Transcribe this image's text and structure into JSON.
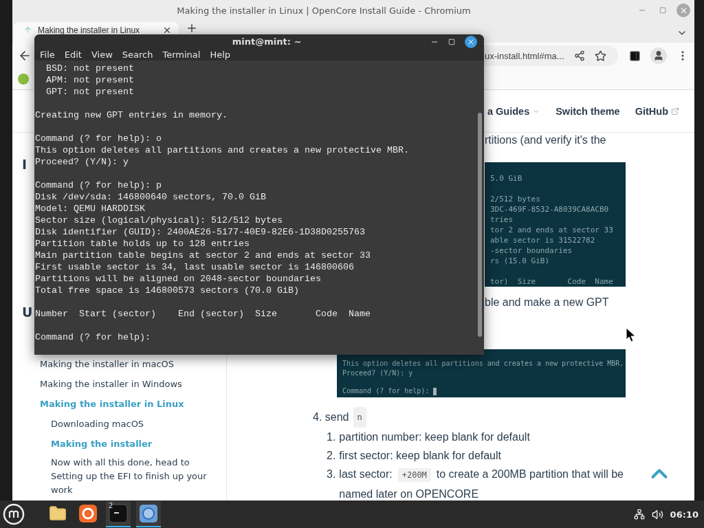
{
  "browser": {
    "title": "Making the installer in Linux | OpenCore Install Guide - Chromium",
    "tabs": [
      {
        "label": "Making the installer in Linux",
        "selected": true
      }
    ],
    "address": "ux-install.html#ma..."
  },
  "site_nav": [
    {
      "label": "a Guides",
      "kind": "dropdown"
    },
    {
      "label": "Switch theme",
      "kind": "plain"
    },
    {
      "label": "GitHub",
      "kind": "external"
    }
  ],
  "sidebar": {
    "headings": [
      "I",
      "U"
    ],
    "items": [
      {
        "label": "Making the installer in macOS",
        "selected": false
      },
      {
        "label": "Making the installer in Windows",
        "selected": false
      },
      {
        "label": "Making the installer in Linux",
        "selected": true,
        "children": [
          {
            "label": "Downloading macOS",
            "selected": false
          },
          {
            "label": "Making the installer",
            "selected": true
          },
          {
            "label": "Now with all this done, head to Setting up the EFI to finish up your work",
            "selected": false
          }
        ]
      }
    ]
  },
  "article": {
    "lead_fragment": "rtitions (and verify it's the",
    "screenshot_1": [
      [
        "5.0 GiB"
      ],
      [
        "2/512 bytes",
        "3DC-469F-8532-A8039CA8ACB0",
        "tries",
        "tor 2 and ends at sector 33",
        "able sector is 31522782",
        "-sector boundaries",
        "rs (15.0 GiB)"
      ],
      [
        "tor)  Size       Code  Name"
      ]
    ],
    "middle_fragment": "ble and make a new GPT",
    "screenshot_2": [
      [
        "This option deletes all partitions and creates a new protective MBR.",
        "Proceed? (Y/N): y"
      ],
      [
        "Command (? for help):"
      ]
    ],
    "step": {
      "number": "4.",
      "text": "send",
      "code": "n",
      "substeps": [
        {
          "number": "1.",
          "parts": [
            {
              "kind": "text",
              "text": "partition number: keep blank for default"
            }
          ]
        },
        {
          "number": "2.",
          "parts": [
            {
              "kind": "text",
              "text": "first sector: keep blank for default"
            }
          ]
        },
        {
          "number": "3.",
          "parts": [
            {
              "kind": "text",
              "text": "last sector:"
            },
            {
              "kind": "code",
              "text": "+200M"
            },
            {
              "kind": "text",
              "text": "to create a 200MB partition that will be named later on OPENCORE"
            }
          ]
        }
      ]
    }
  },
  "terminal": {
    "title": "mint@mint: ~",
    "menu": [
      "File",
      "Edit",
      "View",
      "Search",
      "Terminal",
      "Help"
    ],
    "blocks": [
      [
        "  BSD: not present",
        "  APM: not present",
        "  GPT: not present"
      ],
      [
        "Creating new GPT entries in memory."
      ],
      [
        "Command (? for help): o",
        "This option deletes all partitions and creates a new protective MBR.",
        "Proceed? (Y/N): y"
      ],
      [
        "Command (? for help): p",
        "Disk /dev/sda: 146800640 sectors, 70.0 GiB",
        "Model: QEMU HARDDISK",
        "Sector size (logical/physical): 512/512 bytes",
        "Disk identifier (GUID): 2400AE26-5177-40E9-82E6-1D38D0255763",
        "Partition table holds up to 128 entries",
        "Main partition table begins at sector 2 and ends at sector 33",
        "First usable sector is 34, last usable sector is 146800606",
        "Partitions will be aligned on 2048-sector boundaries",
        "Total free space is 146800573 sectors (70.0 GiB)"
      ],
      [
        "Number  Start (sector)    End (sector)  Size       Code  Name"
      ],
      [
        "Command (? for help):"
      ]
    ]
  },
  "taskbar": {
    "apps": [
      {
        "kind": "files",
        "running": false
      },
      {
        "kind": "firefox",
        "running": false
      },
      {
        "kind": "terminal",
        "running": true,
        "badge": "2"
      },
      {
        "kind": "chromium",
        "running": true
      }
    ],
    "clock": "06:10"
  }
}
